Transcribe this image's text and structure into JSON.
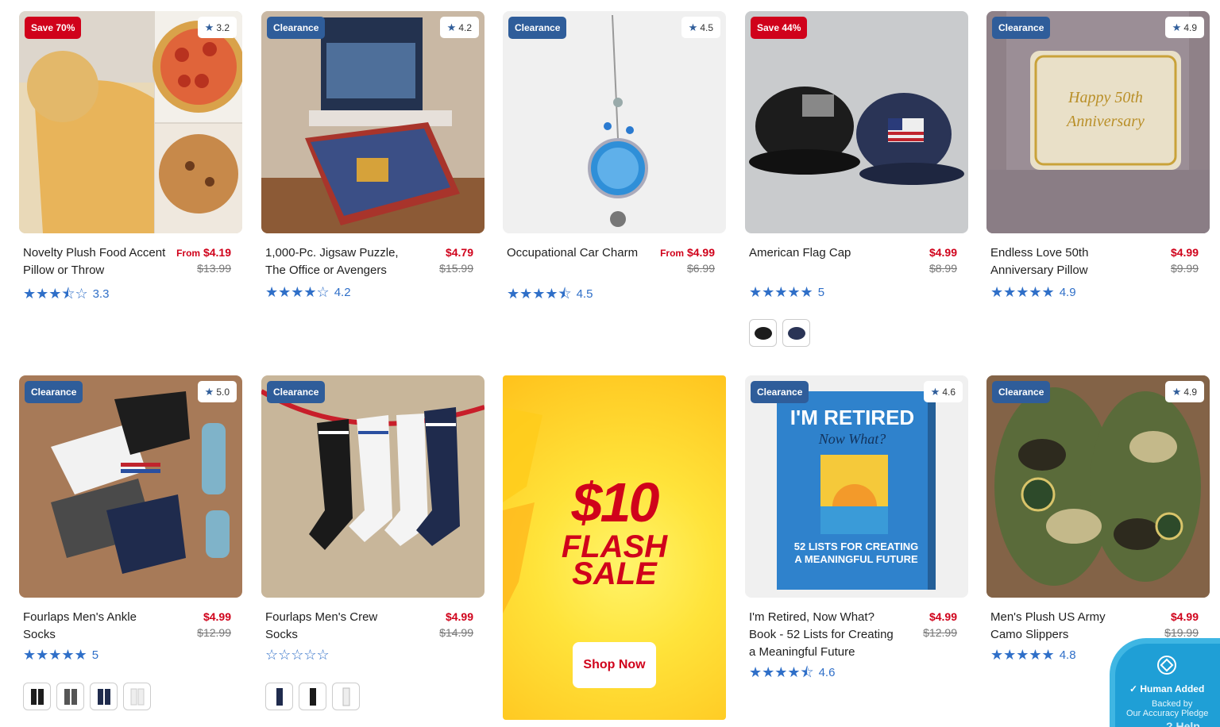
{
  "colors": {
    "accent_blue": "#2f5d9a",
    "sale_red": "#d0021b",
    "star_blue": "#2f6fc8"
  },
  "products": [
    {
      "badge": "Save 70%",
      "badge_type": "save",
      "rating_pill": "3.2",
      "name": "Novelty Plush Food Accent Pillow or Throw",
      "price_prefix": "From",
      "price": "$4.19",
      "was": "$13.99",
      "stars": "★★★⯪☆",
      "rating": "3.3",
      "swatches": []
    },
    {
      "badge": "Clearance",
      "badge_type": "clear",
      "rating_pill": "4.2",
      "name": "1,000-Pc. Jigsaw Puzzle, The Office or Avengers",
      "price_prefix": "",
      "price": "$4.79",
      "was": "$15.99",
      "stars": "★★★★☆",
      "rating": "4.2",
      "swatches": []
    },
    {
      "badge": "Clearance",
      "badge_type": "clear",
      "rating_pill": "4.5",
      "name": "Occupational Car Charm",
      "price_prefix": "From",
      "price": "$4.99",
      "was": "$6.99",
      "stars": "★★★★⯪",
      "rating": "4.5",
      "swatches": []
    },
    {
      "badge": "Save 44%",
      "badge_type": "save",
      "rating_pill": "",
      "name": "American Flag Cap",
      "price_prefix": "",
      "price": "$4.99",
      "was": "$8.99",
      "stars": "★★★★★",
      "rating": "5",
      "swatches": [
        "black-cap",
        "navy-cap"
      ]
    },
    {
      "badge": "Clearance",
      "badge_type": "clear",
      "rating_pill": "4.9",
      "name": "Endless Love 50th Anniversary Pillow",
      "price_prefix": "",
      "price": "$4.99",
      "was": "$9.99",
      "stars": "★★★★★",
      "rating": "4.9",
      "swatches": []
    },
    {
      "badge": "Clearance",
      "badge_type": "clear",
      "rating_pill": "5.0",
      "name": "Fourlaps Men's Ankle Socks",
      "price_prefix": "",
      "price": "$4.99",
      "was": "$12.99",
      "stars": "★★★★★",
      "rating": "5",
      "swatches": [
        "black-sock",
        "gray-sock",
        "navy-sock",
        "white-sock"
      ]
    },
    {
      "badge": "Clearance",
      "badge_type": "clear",
      "rating_pill": "",
      "name": "Fourlaps Men's Crew Socks",
      "price_prefix": "",
      "price": "$4.99",
      "was": "$14.99",
      "stars": "☆☆☆☆☆",
      "rating": "",
      "swatches": [
        "navy-crew",
        "black-crew",
        "white-crew"
      ]
    },
    {
      "badge": "Clearance",
      "badge_type": "clear",
      "rating_pill": "4.6",
      "name": "I'm Retired, Now What? Book - 52 Lists for Creating a Meaningful Future",
      "price_prefix": "",
      "price": "$4.99",
      "was": "$12.99",
      "stars": "★★★★⯪",
      "rating": "4.6",
      "swatches": []
    },
    {
      "badge": "Clearance",
      "badge_type": "clear",
      "rating_pill": "4.9",
      "name": "Men's Plush US Army Camo Slippers",
      "price_prefix": "",
      "price": "$4.99",
      "was": "$19.99",
      "stars": "★★★★★",
      "rating": "4.8",
      "swatches": []
    }
  ],
  "promo": {
    "line1": "$10",
    "line2": "FLASH",
    "line3": "SALE",
    "cta": "Shop Now"
  },
  "help_widget": {
    "title": "Human Added",
    "line1": "Backed by",
    "line2": "Our Accuracy Pledge",
    "help": "Help"
  }
}
